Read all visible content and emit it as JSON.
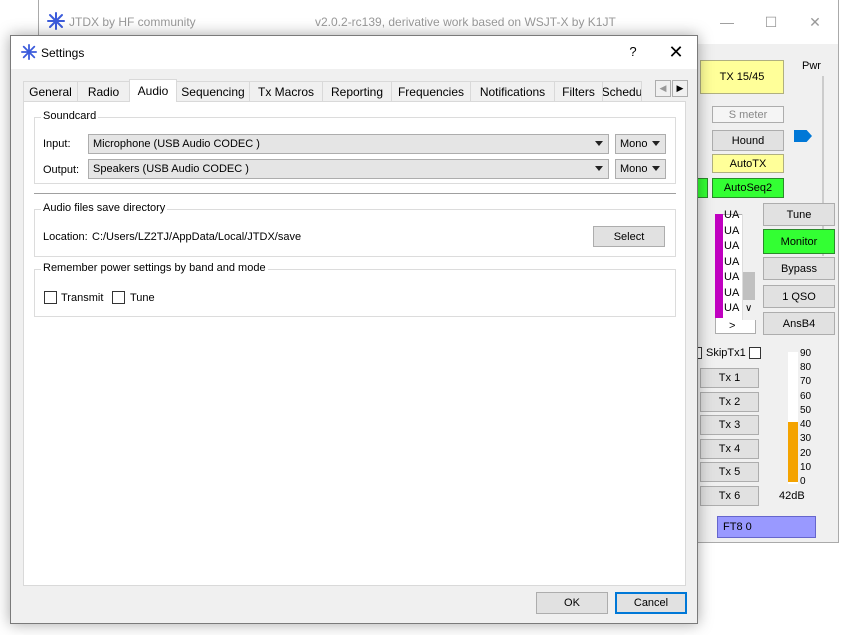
{
  "main_window": {
    "title": "JTDX  by HF community",
    "subtitle": "v2.0.2-rc139, derivative work based on WSJT-X by K1JT",
    "minimize_glyph": "—",
    "maximize_glyph": "☐",
    "close_glyph": "✕",
    "tx_period": "TX 15/45",
    "pwr_label": "Pwr",
    "s_meter": "S meter",
    "hound": "Hound",
    "autotx": "AutoTX",
    "autoseq": "AutoSeq2",
    "tune": "Tune",
    "monitor": "Monitor",
    "bypass": "Bypass",
    "one_qso": "1 QSO",
    "ansb4": "AnsB4",
    "skiptx1": "SkipTx1",
    "tx_buttons": [
      "Tx 1",
      "Tx 2",
      "Tx 3",
      "Tx 4",
      "Tx 5",
      "Tx 6"
    ],
    "decode_rows": [
      "UA",
      "UA",
      "UA",
      "UA",
      "UA",
      "UA",
      "UA"
    ],
    "scroll_down_glyph": "∨",
    "scroll_right_glyph": ">",
    "meter_ticks": [
      "90",
      "80",
      "70",
      "60",
      "50",
      "40",
      "30",
      "20",
      "10",
      "0"
    ],
    "meter_level_db": 42,
    "meter_reading": "42dB",
    "mode": "FT8 0",
    "colors": {
      "yellow": "#ffff99",
      "green": "#33ff33",
      "meter": "#f4a300",
      "mode_bg": "#9999ff",
      "decode_accent": "#c000c0"
    }
  },
  "dialog": {
    "title": "Settings",
    "help_glyph": "?",
    "close_glyph": "✕",
    "tabs": [
      "General",
      "Radio",
      "Audio",
      "Sequencing",
      "Tx Macros",
      "Reporting",
      "Frequencies",
      "Notifications",
      "Filters",
      "Schedu"
    ],
    "active_tab": "Audio",
    "tab_scroll_left": "◀",
    "tab_scroll_right": "▶",
    "soundcard": {
      "title": "Soundcard",
      "input_label": "Input:",
      "input_value": "Microphone (USB Audio CODEC )",
      "input_channel": "Mono",
      "output_label": "Output:",
      "output_value": "Speakers (USB Audio CODEC )",
      "output_channel": "Mono"
    },
    "save_dir": {
      "title": "Audio files save directory",
      "location_label": "Location:",
      "location_value": "C:/Users/LZ2TJ/AppData/Local/JTDX/save",
      "select_button": "Select"
    },
    "power": {
      "title": "Remember power settings by band and mode",
      "transmit_label": "Transmit",
      "transmit_checked": false,
      "tune_label": "Tune",
      "tune_checked": false
    },
    "ok_button": "OK",
    "cancel_button": "Cancel"
  }
}
